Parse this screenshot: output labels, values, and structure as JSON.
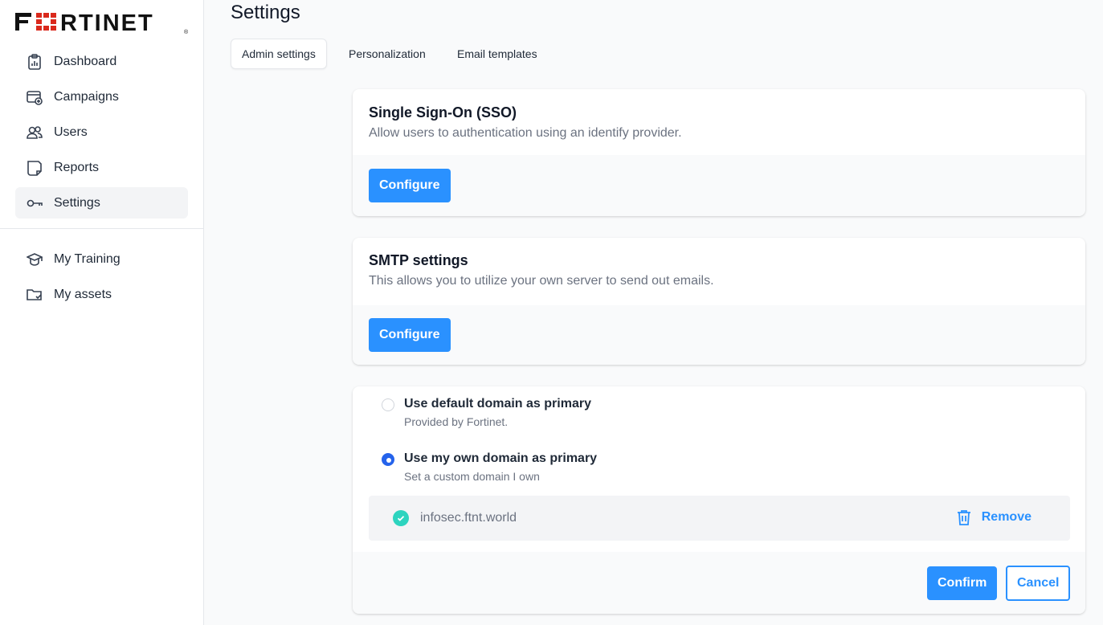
{
  "brand": {
    "logo_text": "FORTINET",
    "accent_color": "#2a91ff",
    "logo_red": "#da291c"
  },
  "sidebar": {
    "items": [
      {
        "label": "Dashboard",
        "icon": "clipboard-chart-icon"
      },
      {
        "label": "Campaigns",
        "icon": "calendar-plus-icon"
      },
      {
        "label": "Users",
        "icon": "users-icon"
      },
      {
        "label": "Reports",
        "icon": "document-icon"
      },
      {
        "label": "Settings",
        "icon": "key-icon",
        "active": true
      }
    ],
    "secondary_items": [
      {
        "label": "My Training",
        "icon": "graduation-cap-icon"
      },
      {
        "label": "My assets",
        "icon": "folder-check-icon"
      }
    ]
  },
  "page": {
    "title": "Settings"
  },
  "tabs": [
    {
      "label": "Admin settings",
      "active": true
    },
    {
      "label": "Personalization"
    },
    {
      "label": "Email templates"
    }
  ],
  "sso": {
    "title": "Single Sign-On (SSO)",
    "description": "Allow users to authentication using an identify provider.",
    "button": "Configure"
  },
  "smtp": {
    "title": "SMTP settings",
    "description": "This allows you to utilize your own server to send out emails.",
    "button": "Configure"
  },
  "domain": {
    "options": [
      {
        "title": "Use default domain as primary",
        "subtitle": "Provided by Fortinet.",
        "checked": false
      },
      {
        "title": "Use my own domain as primary",
        "subtitle": "Set a custom domain I own",
        "checked": true
      }
    ],
    "custom_domain": "infosec.ftnt.world",
    "remove_label": "Remove",
    "confirm_label": "Confirm",
    "cancel_label": "Cancel"
  }
}
